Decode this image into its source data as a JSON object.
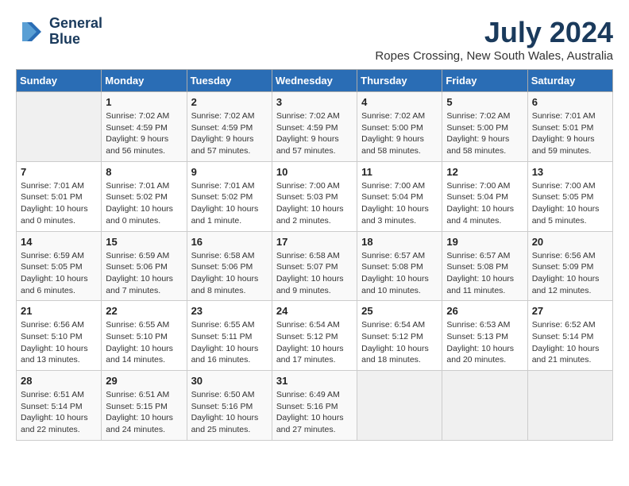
{
  "logo": {
    "line1": "General",
    "line2": "Blue"
  },
  "title": "July 2024",
  "location": "Ropes Crossing, New South Wales, Australia",
  "days_of_week": [
    "Sunday",
    "Monday",
    "Tuesday",
    "Wednesday",
    "Thursday",
    "Friday",
    "Saturday"
  ],
  "weeks": [
    [
      {
        "day": "",
        "info": ""
      },
      {
        "day": "1",
        "info": "Sunrise: 7:02 AM\nSunset: 4:59 PM\nDaylight: 9 hours\nand 56 minutes."
      },
      {
        "day": "2",
        "info": "Sunrise: 7:02 AM\nSunset: 4:59 PM\nDaylight: 9 hours\nand 57 minutes."
      },
      {
        "day": "3",
        "info": "Sunrise: 7:02 AM\nSunset: 4:59 PM\nDaylight: 9 hours\nand 57 minutes."
      },
      {
        "day": "4",
        "info": "Sunrise: 7:02 AM\nSunset: 5:00 PM\nDaylight: 9 hours\nand 58 minutes."
      },
      {
        "day": "5",
        "info": "Sunrise: 7:02 AM\nSunset: 5:00 PM\nDaylight: 9 hours\nand 58 minutes."
      },
      {
        "day": "6",
        "info": "Sunrise: 7:01 AM\nSunset: 5:01 PM\nDaylight: 9 hours\nand 59 minutes."
      }
    ],
    [
      {
        "day": "7",
        "info": "Sunrise: 7:01 AM\nSunset: 5:01 PM\nDaylight: 10 hours\nand 0 minutes."
      },
      {
        "day": "8",
        "info": "Sunrise: 7:01 AM\nSunset: 5:02 PM\nDaylight: 10 hours\nand 0 minutes."
      },
      {
        "day": "9",
        "info": "Sunrise: 7:01 AM\nSunset: 5:02 PM\nDaylight: 10 hours\nand 1 minute."
      },
      {
        "day": "10",
        "info": "Sunrise: 7:00 AM\nSunset: 5:03 PM\nDaylight: 10 hours\nand 2 minutes."
      },
      {
        "day": "11",
        "info": "Sunrise: 7:00 AM\nSunset: 5:04 PM\nDaylight: 10 hours\nand 3 minutes."
      },
      {
        "day": "12",
        "info": "Sunrise: 7:00 AM\nSunset: 5:04 PM\nDaylight: 10 hours\nand 4 minutes."
      },
      {
        "day": "13",
        "info": "Sunrise: 7:00 AM\nSunset: 5:05 PM\nDaylight: 10 hours\nand 5 minutes."
      }
    ],
    [
      {
        "day": "14",
        "info": "Sunrise: 6:59 AM\nSunset: 5:05 PM\nDaylight: 10 hours\nand 6 minutes."
      },
      {
        "day": "15",
        "info": "Sunrise: 6:59 AM\nSunset: 5:06 PM\nDaylight: 10 hours\nand 7 minutes."
      },
      {
        "day": "16",
        "info": "Sunrise: 6:58 AM\nSunset: 5:06 PM\nDaylight: 10 hours\nand 8 minutes."
      },
      {
        "day": "17",
        "info": "Sunrise: 6:58 AM\nSunset: 5:07 PM\nDaylight: 10 hours\nand 9 minutes."
      },
      {
        "day": "18",
        "info": "Sunrise: 6:57 AM\nSunset: 5:08 PM\nDaylight: 10 hours\nand 10 minutes."
      },
      {
        "day": "19",
        "info": "Sunrise: 6:57 AM\nSunset: 5:08 PM\nDaylight: 10 hours\nand 11 minutes."
      },
      {
        "day": "20",
        "info": "Sunrise: 6:56 AM\nSunset: 5:09 PM\nDaylight: 10 hours\nand 12 minutes."
      }
    ],
    [
      {
        "day": "21",
        "info": "Sunrise: 6:56 AM\nSunset: 5:10 PM\nDaylight: 10 hours\nand 13 minutes."
      },
      {
        "day": "22",
        "info": "Sunrise: 6:55 AM\nSunset: 5:10 PM\nDaylight: 10 hours\nand 14 minutes."
      },
      {
        "day": "23",
        "info": "Sunrise: 6:55 AM\nSunset: 5:11 PM\nDaylight: 10 hours\nand 16 minutes."
      },
      {
        "day": "24",
        "info": "Sunrise: 6:54 AM\nSunset: 5:12 PM\nDaylight: 10 hours\nand 17 minutes."
      },
      {
        "day": "25",
        "info": "Sunrise: 6:54 AM\nSunset: 5:12 PM\nDaylight: 10 hours\nand 18 minutes."
      },
      {
        "day": "26",
        "info": "Sunrise: 6:53 AM\nSunset: 5:13 PM\nDaylight: 10 hours\nand 20 minutes."
      },
      {
        "day": "27",
        "info": "Sunrise: 6:52 AM\nSunset: 5:14 PM\nDaylight: 10 hours\nand 21 minutes."
      }
    ],
    [
      {
        "day": "28",
        "info": "Sunrise: 6:51 AM\nSunset: 5:14 PM\nDaylight: 10 hours\nand 22 minutes."
      },
      {
        "day": "29",
        "info": "Sunrise: 6:51 AM\nSunset: 5:15 PM\nDaylight: 10 hours\nand 24 minutes."
      },
      {
        "day": "30",
        "info": "Sunrise: 6:50 AM\nSunset: 5:16 PM\nDaylight: 10 hours\nand 25 minutes."
      },
      {
        "day": "31",
        "info": "Sunrise: 6:49 AM\nSunset: 5:16 PM\nDaylight: 10 hours\nand 27 minutes."
      },
      {
        "day": "",
        "info": ""
      },
      {
        "day": "",
        "info": ""
      },
      {
        "day": "",
        "info": ""
      }
    ]
  ]
}
